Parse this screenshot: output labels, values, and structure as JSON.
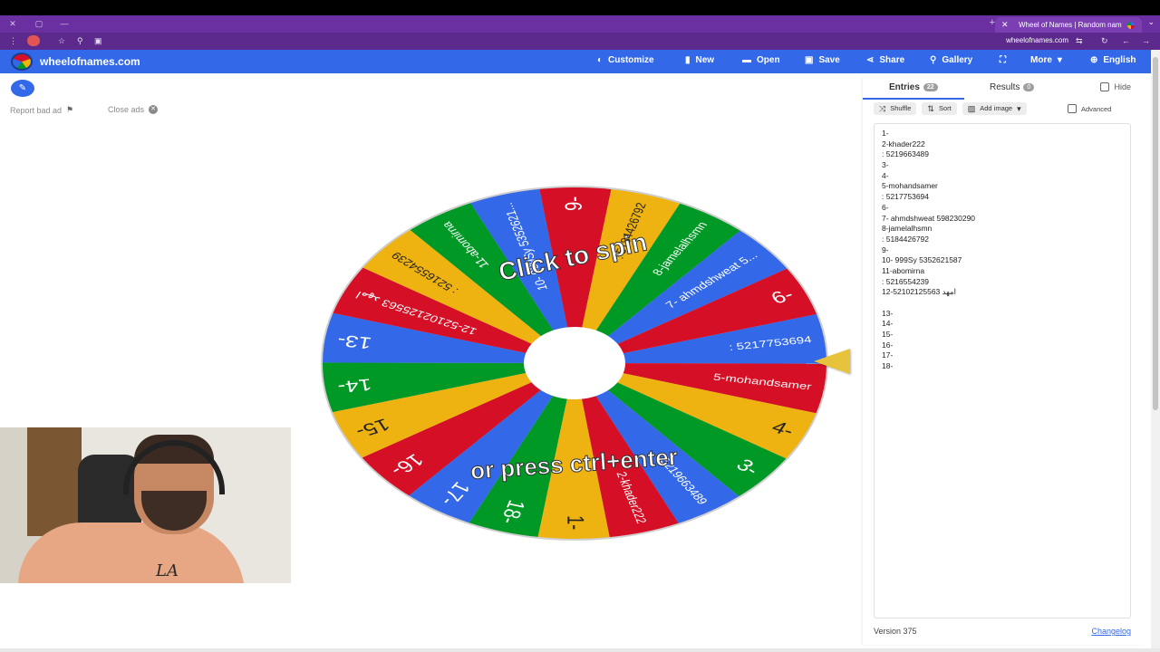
{
  "browser": {
    "tab_title": "Wheel of Names | Random nam",
    "tab_close": "✕",
    "new_tab": "+",
    "url": "wheelofnames.com"
  },
  "nav": {
    "brand": "wheelofnames.com",
    "items": [
      {
        "label": "Customize",
        "icon": "palette-icon",
        "glyph": "◐"
      },
      {
        "label": "New",
        "icon": "file-icon",
        "glyph": "▮"
      },
      {
        "label": "Open",
        "icon": "folder-icon",
        "glyph": "▬"
      },
      {
        "label": "Save",
        "icon": "save-icon",
        "glyph": "▣"
      },
      {
        "label": "Share",
        "icon": "share-icon",
        "glyph": "⋖"
      },
      {
        "label": "Gallery",
        "icon": "search-icon",
        "glyph": "⚲"
      },
      {
        "label": "",
        "icon": "fullscreen-icon",
        "glyph": "⛶"
      },
      {
        "label": "More",
        "icon": "chevron-down-icon",
        "glyph": "▾"
      },
      {
        "label": "English",
        "icon": "globe-icon",
        "glyph": "⊕"
      }
    ]
  },
  "left": {
    "report_bad_ad": "Report bad ad",
    "close_ads": "Close ads"
  },
  "wheel": {
    "center_text_top": "Click to spin",
    "center_text_bottom": "or press ctrl+enter",
    "colors": [
      "#3369e8",
      "#d50f25",
      "#eeb211",
      "#009925"
    ],
    "slices": [
      ": 5217753694",
      "5-mohandsamer",
      "4-",
      "3-",
      ": 5219663489",
      "2-khader222",
      "1-",
      "18-",
      "17-",
      "16-",
      "15-",
      "14-",
      "13-",
      "12-52102125563 امهد",
      ": 5216554239",
      "11-abomirna",
      "10- 999Sy 5352621...",
      "9-",
      ": 5184426792",
      "8-jamelalhsmn",
      "7- ahmdshweat 5...",
      "6-"
    ]
  },
  "panel": {
    "entries_label": "Entries",
    "entries_count": "22",
    "results_label": "Results",
    "results_count": "0",
    "hide_label": "Hide",
    "shuffle_label": "Shuffle",
    "sort_label": "Sort",
    "add_image_label": "Add image",
    "advanced_label": "Advanced",
    "entries": [
      "1-",
      "2-khader222",
      ": 5219663489",
      "3-",
      "4-",
      "5-mohandsamer",
      ": 5217753694",
      "6-",
      "7- ahmdshweat 598230290",
      "8-jamelalhsmn",
      ": 5184426792",
      "9-",
      "10- 999Sy 5352621587",
      "11-abomirna",
      ": 5216554239",
      "12-52102125563 امهد",
      "",
      "13-",
      "14-",
      "15-",
      "16-",
      "17-",
      "18-"
    ],
    "version": "Version 375",
    "changelog": "Changelog"
  }
}
